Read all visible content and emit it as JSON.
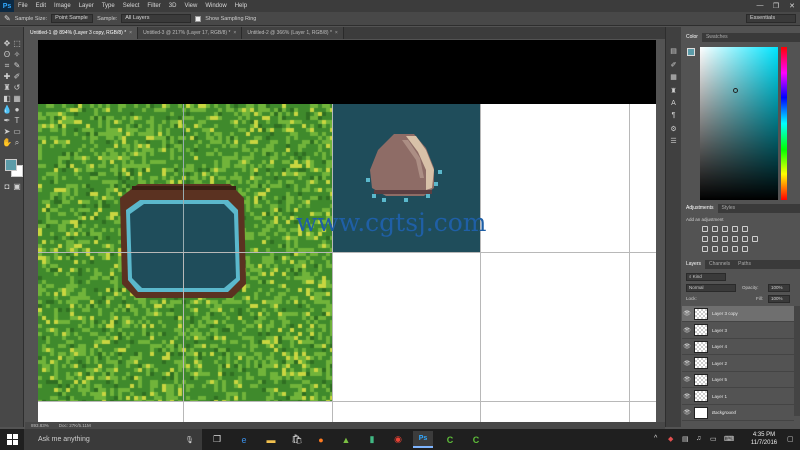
{
  "app": {
    "logo": "Ps"
  },
  "menu": [
    "File",
    "Edit",
    "Image",
    "Layer",
    "Type",
    "Select",
    "Filter",
    "3D",
    "View",
    "Window",
    "Help"
  ],
  "window_controls": [
    "—",
    "❐",
    "✕"
  ],
  "options": {
    "sample_size_label": "Sample Size:",
    "sample_size_value": "Point Sample",
    "sample_label": "Sample:",
    "sample_value": "All Layers",
    "show_ring_label": "Show Sampling Ring",
    "workspace": "Essentials"
  },
  "tabs": [
    {
      "label": "Untitled-1 @ 894% (Layer 3 copy, RGB/8) *",
      "active": true
    },
    {
      "label": "Untitled-3 @ 217% (Layer 17, RGB/8) *",
      "active": false
    },
    {
      "label": "Untitled-2 @ 366% (Layer 1, RGB/8) *",
      "active": false
    }
  ],
  "tab_close": "×",
  "status": {
    "zoom": "893.83%",
    "doc": "Doc: 27K/5.11M"
  },
  "watermark": "www.cgtsj.com",
  "panels": {
    "color_tabs": [
      "Color",
      "Swatches"
    ],
    "adjust_tabs": [
      "Adjustments",
      "Styles"
    ],
    "adjust_hint": "Add an adjustment",
    "layers_tabs": [
      "Layers",
      "Channels",
      "Paths"
    ],
    "kind": "Kind",
    "blend_mode": "Normal",
    "opacity_label": "Opacity:",
    "opacity_value": "100%",
    "lock_label": "Lock:",
    "fill_label": "Fill:",
    "fill_value": "100%",
    "layers": [
      {
        "name": "Layer 3 copy",
        "selected": true
      },
      {
        "name": "Layer 3",
        "selected": false
      },
      {
        "name": "Layer 4",
        "selected": false
      },
      {
        "name": "Layer 2",
        "selected": false
      },
      {
        "name": "Layer 5",
        "selected": false
      },
      {
        "name": "Layer 1",
        "selected": false
      },
      {
        "name": "Background",
        "selected": false
      }
    ]
  },
  "taskbar": {
    "search_placeholder": "Ask me anything",
    "time": "4:35 PM",
    "date": "11/7/2016"
  },
  "colors": {
    "grass_dark": "#3f8a2c",
    "grass_light": "#71b43a",
    "grass_yellow": "#c9d640",
    "water": "#1f4d5b",
    "foreground": "#5b9ba8"
  }
}
